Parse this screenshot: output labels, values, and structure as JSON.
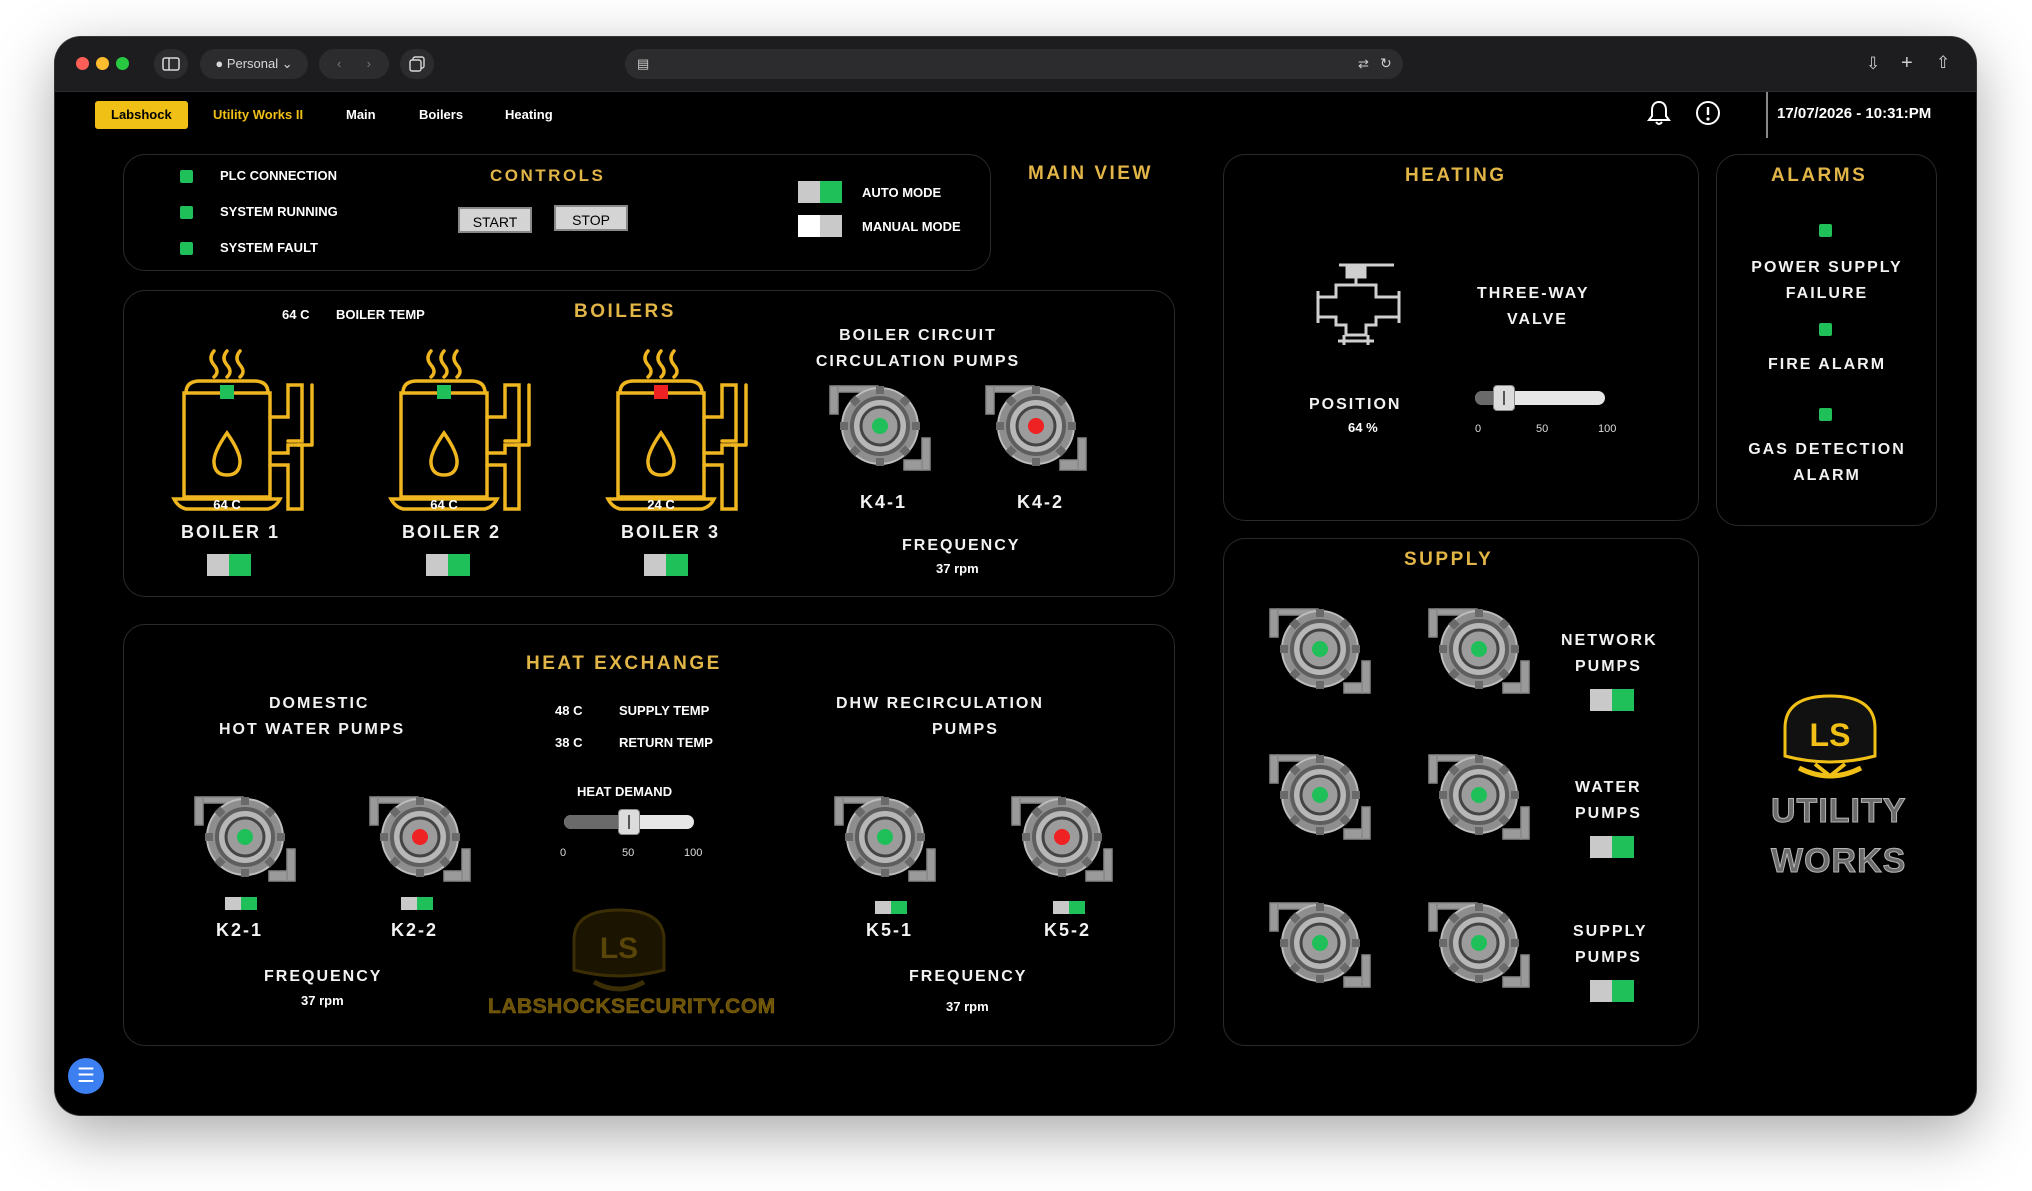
{
  "browser": {
    "profile_label": "Personal",
    "profile_icon": "person-icon"
  },
  "nav": {
    "items": [
      "Labshock",
      "Utility Works II",
      "Main",
      "Boilers",
      "Heating"
    ],
    "datetime": "17/07/2026 - 10:31:PM"
  },
  "status": {
    "items": [
      "PLC CONNECTION",
      "SYSTEM RUNNING",
      "SYSTEM FAULT"
    ]
  },
  "controls": {
    "title": "CONTROLS",
    "start_label": "START",
    "stop_label": "STOP",
    "auto_mode_label": "AUTO MODE",
    "manual_mode_label": "MANUAL MODE",
    "auto_mode_on": true,
    "manual_mode_on": false
  },
  "main_view_title": "MAIN VIEW",
  "boilers": {
    "title": "BOILERS",
    "temp_value": "64 C",
    "temp_label": "BOILER TEMP",
    "units": [
      {
        "name": "BOILER 1",
        "temp": "64 C",
        "status": "green",
        "on": true
      },
      {
        "name": "BOILER 2",
        "temp": "64 C",
        "status": "green",
        "on": true
      },
      {
        "name": "BOILER 3",
        "temp": "24 C",
        "status": "red",
        "on": true
      }
    ],
    "circ_title_1": "BOILER CIRCUIT",
    "circ_title_2": "CIRCULATION PUMPS",
    "pumps": [
      {
        "name": "K4-1",
        "status": "green"
      },
      {
        "name": "K4-2",
        "status": "red"
      }
    ],
    "frequency_label": "FREQUENCY",
    "frequency_value": "37 rpm"
  },
  "heat_exchange": {
    "title": "HEAT EXCHANGE",
    "dhw_title_1": "DOMESTIC",
    "dhw_title_2": "HOT WATER PUMPS",
    "dhw_pumps": [
      {
        "name": "K2-1",
        "status": "green",
        "on": true
      },
      {
        "name": "K2-2",
        "status": "red",
        "on": true
      }
    ],
    "dhw_frequency_label": "FREQUENCY",
    "dhw_frequency_value": "37 rpm",
    "supply_temp_value": "48 C",
    "supply_temp_label": "SUPPLY TEMP",
    "return_temp_value": "38 C",
    "return_temp_label": "RETURN TEMP",
    "heat_demand_label": "HEAT DEMAND",
    "heat_demand_fraction": 0.5,
    "heat_demand_ticks": [
      "0",
      "50",
      "100"
    ],
    "recirc_title_1": "DHW RECIRCULATION",
    "recirc_title_2": "PUMPS",
    "recirc_pumps": [
      {
        "name": "K5-1",
        "status": "green",
        "on": true
      },
      {
        "name": "K5-2",
        "status": "red",
        "on": true
      }
    ],
    "recirc_frequency_label": "FREQUENCY",
    "recirc_frequency_value": "37 rpm",
    "watermark_text": "LABSHOCKSECURITY.COM"
  },
  "heating": {
    "title": "HEATING",
    "valve_label_1": "THREE-WAY",
    "valve_label_2": "VALVE",
    "position_label": "POSITION",
    "position_value": "64 %",
    "position_fraction": 0.22,
    "ticks": [
      "0",
      "50",
      "100"
    ]
  },
  "supply": {
    "title": "SUPPLY",
    "groups": [
      {
        "label_1": "NETWORK",
        "label_2": "PUMPS",
        "on": true
      },
      {
        "label_1": "WATER",
        "label_2": "PUMPS",
        "on": true
      },
      {
        "label_1": "SUPPLY",
        "label_2": "PUMPS",
        "on": true
      }
    ]
  },
  "alarms": {
    "title": "ALARMS",
    "items": [
      {
        "line_1": "POWER SUPPLY",
        "line_2": "FAILURE"
      },
      {
        "line_1": "FIRE ALARM",
        "line_2": ""
      },
      {
        "line_1": "GAS DETECTION",
        "line_2": "ALARM"
      }
    ]
  },
  "logo": {
    "badge_text": "LS",
    "line_1": "UTILITY",
    "line_2": "WORKS"
  },
  "colors": {
    "accent": "#f0c016",
    "heading": "#e2b547",
    "ok": "#1fc05a",
    "fault": "#ee2222",
    "background": "#000000"
  }
}
